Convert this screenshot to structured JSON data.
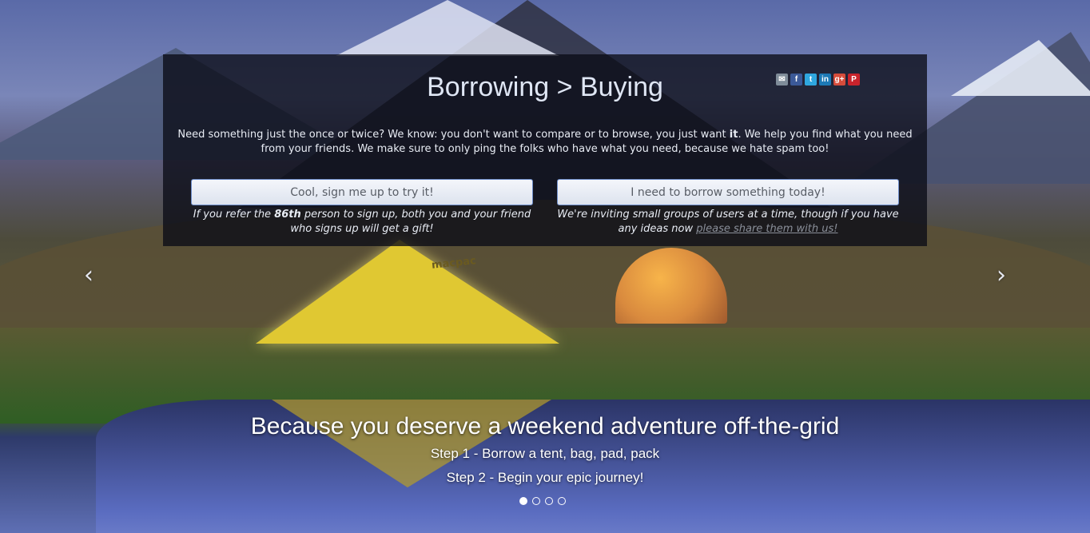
{
  "hero": {
    "title": "Borrowing > Buying",
    "description_part1": "Need something just the once or twice? We know: you don't want to compare or to browse, you just want ",
    "description_emphasis": "it",
    "description_part2": ". We help you find what you need from your friends. We make sure to only ping the folks who have what you need, because we hate spam too!",
    "tent_brand": "macpac"
  },
  "share": {
    "icons": [
      "email-icon",
      "facebook-icon",
      "twitter-icon",
      "linkedin-icon",
      "google-plus-icon",
      "pinterest-icon"
    ],
    "glyphs": {
      "email": "✉",
      "facebook": "f",
      "twitter": "t",
      "linkedin": "in",
      "gplus": "g+",
      "pinterest": "P"
    }
  },
  "actions": {
    "signup_label": "Cool, sign me up to try it!",
    "borrow_label": "I need to borrow something today!",
    "signup_note_part1": "If you refer the ",
    "signup_note_emphasis": "86th",
    "signup_note_part2": " person to sign up, both you and your friend who signs up will get a gift!",
    "borrow_note_text": "We're inviting small groups of users at a time, though if you have any ideas now ",
    "borrow_note_link": "please share them with us!"
  },
  "carousel": {
    "prev_glyph": "‹",
    "next_glyph": "›",
    "caption_title": "Because you deserve a weekend adventure off-the-grid",
    "caption_step1": "Step 1 - Borrow a tent, bag, pad, pack",
    "caption_step2": "Step 2 - Begin your epic journey!",
    "slide_count": 4,
    "active_slide": 1
  },
  "colors": {
    "panel_bg": "#0a0c16",
    "button_border": "#6d8cc9",
    "link_muted": "#8a8f99"
  }
}
